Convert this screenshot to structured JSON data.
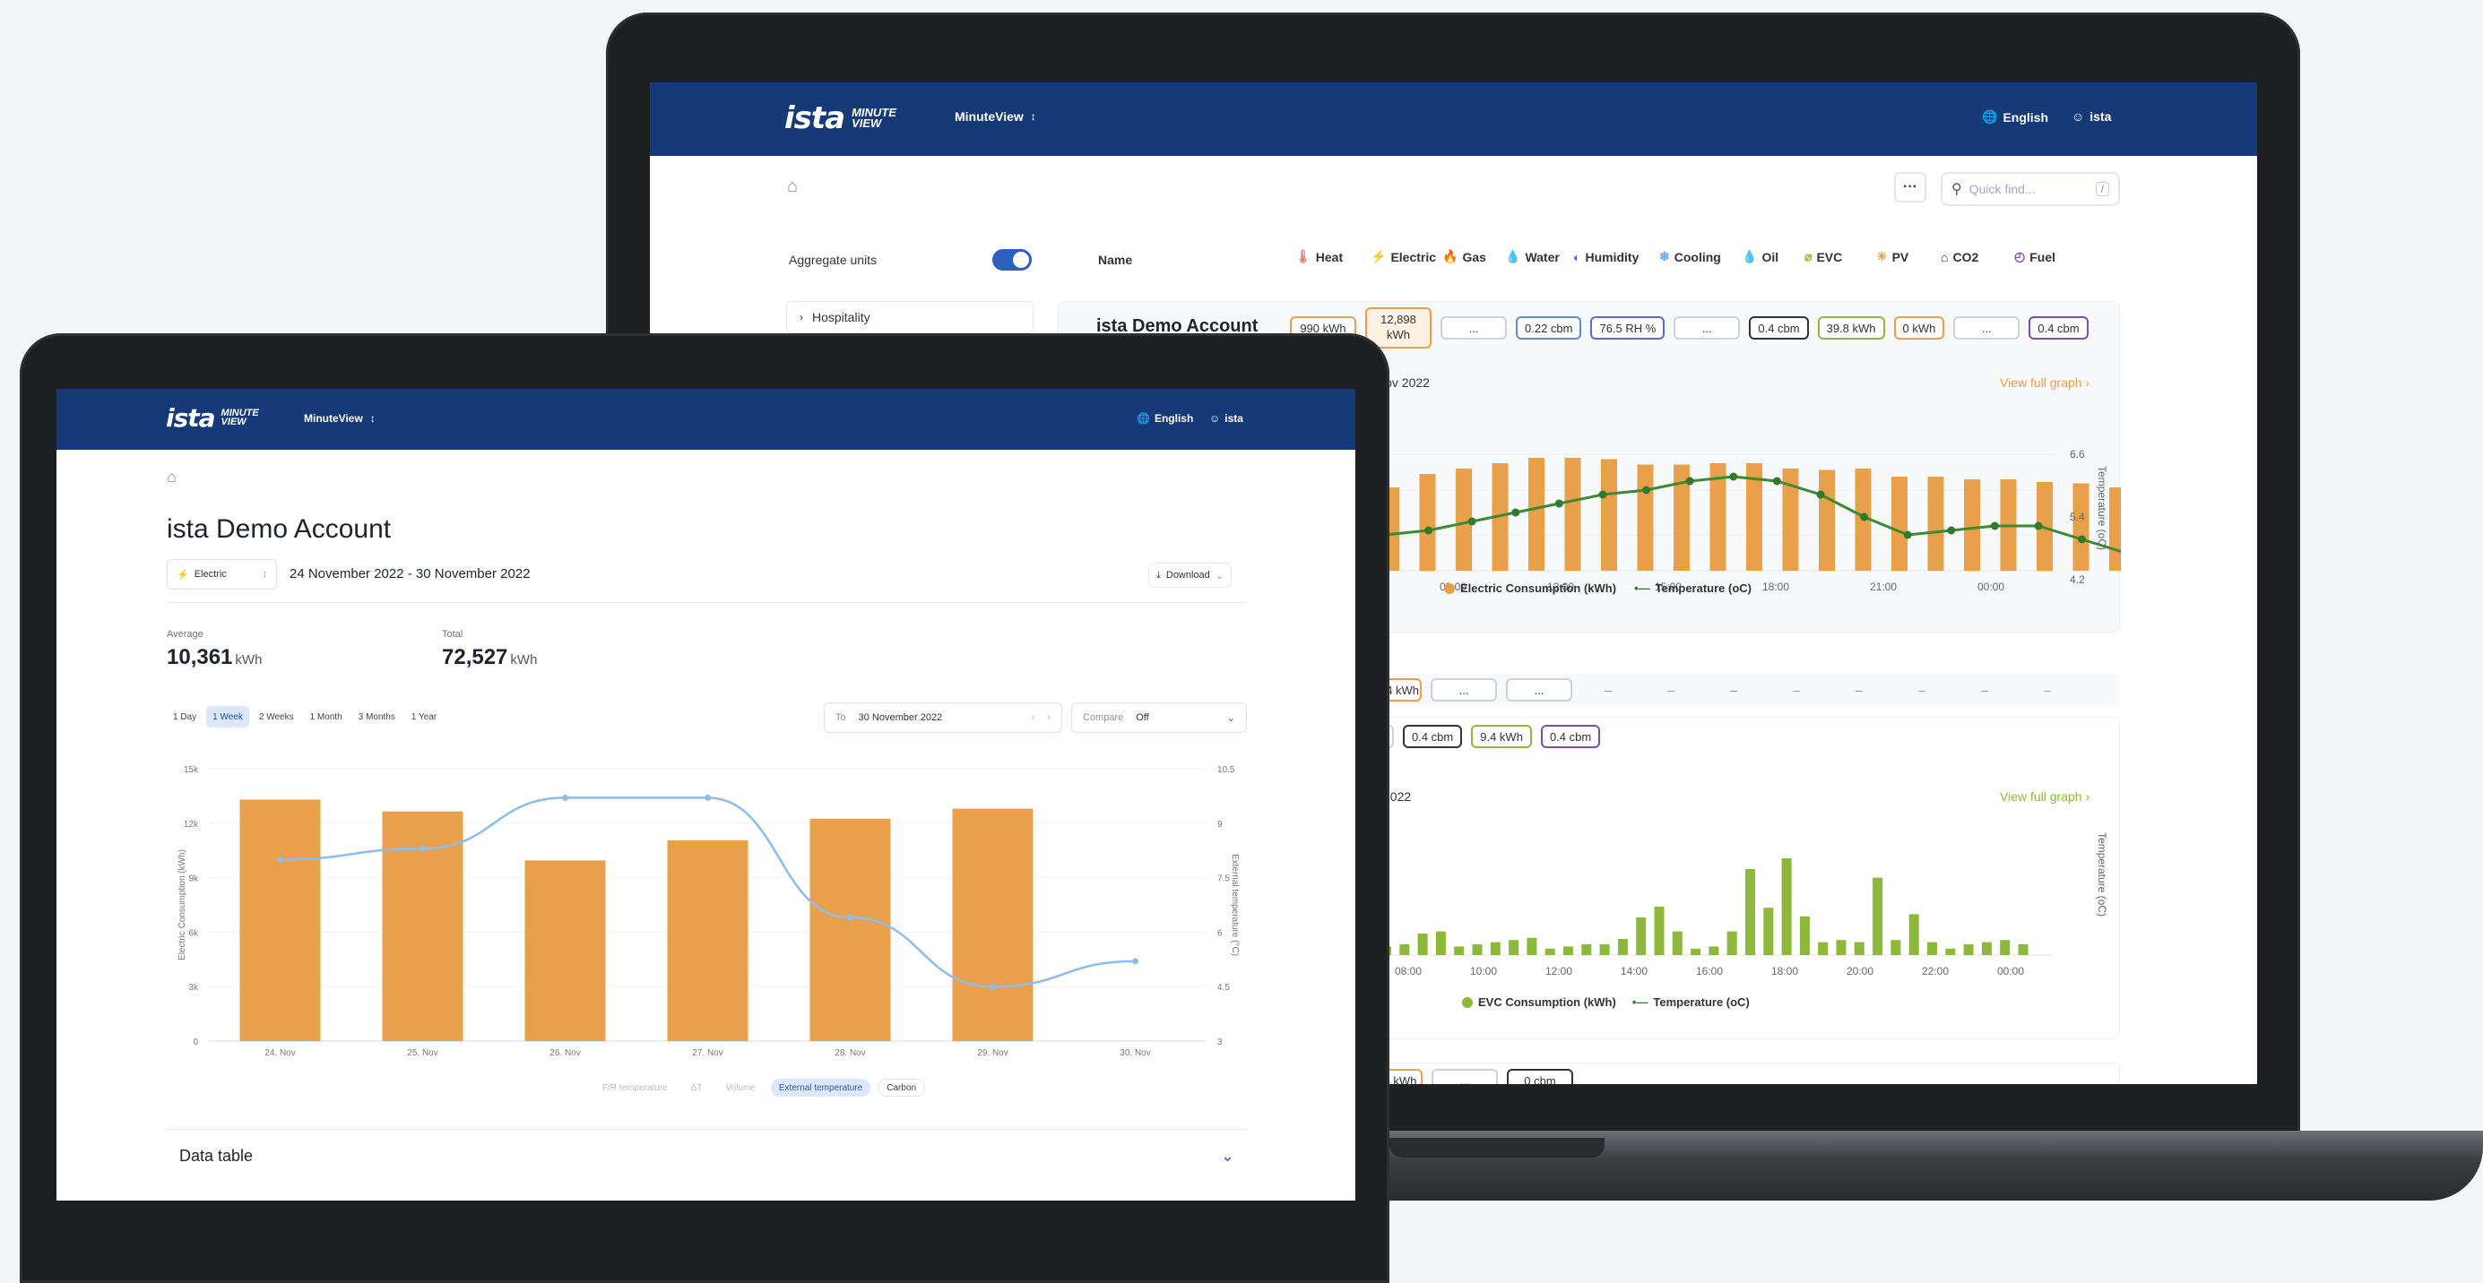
{
  "brand": {
    "logo": "ista",
    "logo_sub_1": "MINUTE",
    "logo_sub_2": "VIEW",
    "app_switcher": "MinuteView"
  },
  "header": {
    "language": "English",
    "user": "ista"
  },
  "colors": {
    "brand_blue": "#163a77",
    "electric_orange": "#e8a04b",
    "evc_green": "#8db83a",
    "temp_green": "#2f7a2f",
    "temp_blue": "#8cbcf0",
    "toggle_blue": "#2f5fbe"
  },
  "laptop": {
    "search_placeholder": "Quick find...",
    "search_shortcut": "/",
    "more_label": "···",
    "aggregate_label": "Aggregate units",
    "name_header": "Name",
    "utilities": [
      {
        "label": "Heat",
        "icon": "thermometer-icon",
        "color": "#e8766b"
      },
      {
        "label": "Electric",
        "icon": "bolt-icon",
        "color": "#e8a04b"
      },
      {
        "label": "Gas",
        "icon": "flame-icon",
        "color": "#c98ad6"
      },
      {
        "label": "Water",
        "icon": "droplet-icon",
        "color": "#5a8fd6"
      },
      {
        "label": "Humidity",
        "icon": "humidity-icon",
        "color": "#5b6bd6"
      },
      {
        "label": "Cooling",
        "icon": "snow-thermometer-icon",
        "color": "#6aa6e8"
      },
      {
        "label": "Oil",
        "icon": "oil-drop-icon",
        "color": "#333"
      },
      {
        "label": "EVC",
        "icon": "plug-icon",
        "color": "#8db83a"
      },
      {
        "label": "PV",
        "icon": "sun-icon",
        "color": "#e8a04b"
      },
      {
        "label": "CO2",
        "icon": "house-co2-icon",
        "color": "#333"
      },
      {
        "label": "Fuel",
        "icon": "gauge-icon",
        "color": "#7d4fb0"
      }
    ],
    "sidebar_item": "Hospitality",
    "account_name": "ista Demo Account",
    "row1_values": [
      "990 kWh",
      "12,898 kWh",
      "...",
      "0.22 cbm",
      "76.5 RH %",
      "...",
      "0.4 cbm",
      "39.8 kWh",
      "0 kWh",
      "...",
      "0.4 cbm"
    ],
    "graph1": {
      "title_fragment": "Nov 2022",
      "view_full": "View full graph",
      "legend_bar": "Electric Consumption (kWh)",
      "legend_line": "Temperature (oC)",
      "y2_label": "Temperature (oC)",
      "x_ticks": [
        "09:00",
        "12:00",
        "15:00",
        "18:00",
        "21:00",
        "00:00"
      ],
      "y2_ticks": [
        "6.6",
        "5.4",
        "4.2"
      ]
    },
    "row2_values": [
      "54 kWh",
      "...",
      "..."
    ],
    "row3_values": [
      "...",
      "0.4 cbm",
      "9.4 kWh",
      "0.4 cbm"
    ],
    "dash": "–",
    "graph2": {
      "title_fragment": "2022",
      "view_full": "View full graph",
      "legend_bar": "EVC Consumption (kWh)",
      "legend_line": "Temperature (oC)",
      "y2_label": "Temperature (oC)",
      "x_ticks": [
        "08:00",
        "10:00",
        "12:00",
        "14:00",
        "16:00",
        "18:00",
        "20:00",
        "22:00",
        "00:00"
      ]
    },
    "row4_values": [
      "6 kWh",
      "...",
      "0 cbm"
    ]
  },
  "tablet": {
    "page_title": "ista Demo Account",
    "utility_select": "Electric",
    "date_range": "24 November 2022 - 30 November 2022",
    "download": "Download",
    "average_label": "Average",
    "average_value": "10,361",
    "average_unit": "kWh",
    "total_label": "Total",
    "total_value": "72,527",
    "total_unit": "kWh",
    "ranges": [
      "1 Day",
      "1 Week",
      "2 Weeks",
      "1 Month",
      "3 Months",
      "1 Year"
    ],
    "active_range": "1 Week",
    "to_label": "To",
    "to_value": "30 November 2022",
    "compare_label": "Compare",
    "compare_value": "Off",
    "filters": [
      {
        "label": "F/R temperature",
        "state": "off"
      },
      {
        "label": "ΔT",
        "state": "off"
      },
      {
        "label": "Volume",
        "state": "off"
      },
      {
        "label": "External temperature",
        "state": "active"
      },
      {
        "label": "Carbon",
        "state": "on"
      }
    ],
    "data_table": "Data table"
  },
  "chart_data": [
    {
      "type": "bar",
      "categories": [
        "24. Nov",
        "25. Nov",
        "26. Nov",
        "27. Nov",
        "28. Nov",
        "29. Nov",
        "30. Nov"
      ],
      "series": [
        {
          "name": "Electric Consumption (kWh)",
          "values": [
            13300,
            12650,
            9950,
            11050,
            12250,
            12800,
            null
          ]
        },
        {
          "name": "External temperature (°C)",
          "type": "line",
          "values": [
            8.0,
            8.3,
            9.7,
            9.7,
            6.4,
            4.5,
            5.2
          ]
        }
      ],
      "xlabel": "",
      "ylabel": "Electric Consumption (kWh)",
      "y2label": "External temperature (°C)",
      "y_ticks": [
        "0",
        "3k",
        "6k",
        "9k",
        "12k",
        "15k"
      ],
      "y2_ticks": [
        "3",
        "4.5",
        "6",
        "7.5",
        "9",
        "10.5"
      ],
      "ylim": [
        0,
        15000
      ],
      "y2lim": [
        3,
        10.5
      ]
    },
    {
      "type": "bar",
      "categories": [
        "07:00",
        "07:30",
        "08:00",
        "08:30",
        "09:00",
        "09:30",
        "10:00",
        "10:30",
        "11:00",
        "11:30",
        "12:00",
        "12:30",
        "13:00",
        "13:30",
        "14:00",
        "14:30",
        "15:00",
        "15:30",
        "16:00",
        "16:30",
        "17:00",
        "17:30",
        "18:00",
        "18:30",
        "19:00",
        "19:30",
        "20:00",
        "20:30",
        "21:00",
        "21:30",
        "22:00",
        "22:30",
        "23:00",
        "23:30",
        "00:00"
      ],
      "series": [
        {
          "name": "Electric Consumption (kWh)",
          "values": [
            0.62,
            0.72,
            0.76,
            0.8,
            0.84,
            0.84,
            0.83,
            0.79,
            0.79,
            0.8,
            0.8,
            0.76,
            0.75,
            0.76,
            0.7,
            0.7,
            0.68,
            0.68,
            0.66,
            0.65,
            0.62,
            0.62,
            0.6,
            0.61,
            0.6
          ]
        },
        {
          "name": "Temperature (oC)",
          "type": "line",
          "values": [
            4.8,
            4.9,
            5.1,
            5.3,
            5.5,
            5.7,
            5.8,
            6.0,
            6.1,
            6.0,
            5.7,
            5.2,
            4.8,
            4.9,
            5.0,
            5.0,
            4.7,
            4.4,
            4.3,
            4.4,
            4.8
          ]
        }
      ],
      "y2_ticks": [
        "4.2",
        "5.4",
        "6.6"
      ],
      "x_ticks": [
        "09:00",
        "12:00",
        "15:00",
        "18:00",
        "21:00",
        "00:00"
      ]
    },
    {
      "type": "bar",
      "series": [
        {
          "name": "EVC Consumption (kWh)",
          "values": [
            0.08,
            0.1,
            0.2,
            0.22,
            0.08,
            0.1,
            0.12,
            0.14,
            0.16,
            0.06,
            0.08,
            0.1,
            0.1,
            0.15,
            0.35,
            0.45,
            0.22,
            0.06,
            0.08,
            0.22,
            0.8,
            0.44,
            0.9,
            0.36,
            0.12,
            0.14,
            0.12,
            0.72,
            0.14,
            0.38,
            0.12,
            0.06,
            0.1,
            0.12,
            0.14,
            0.1
          ]
        },
        {
          "name": "Temperature (oC)",
          "type": "line",
          "values": []
        }
      ],
      "x_ticks": [
        "08:00",
        "10:00",
        "12:00",
        "14:00",
        "16:00",
        "18:00",
        "20:00",
        "22:00",
        "00:00"
      ]
    }
  ]
}
